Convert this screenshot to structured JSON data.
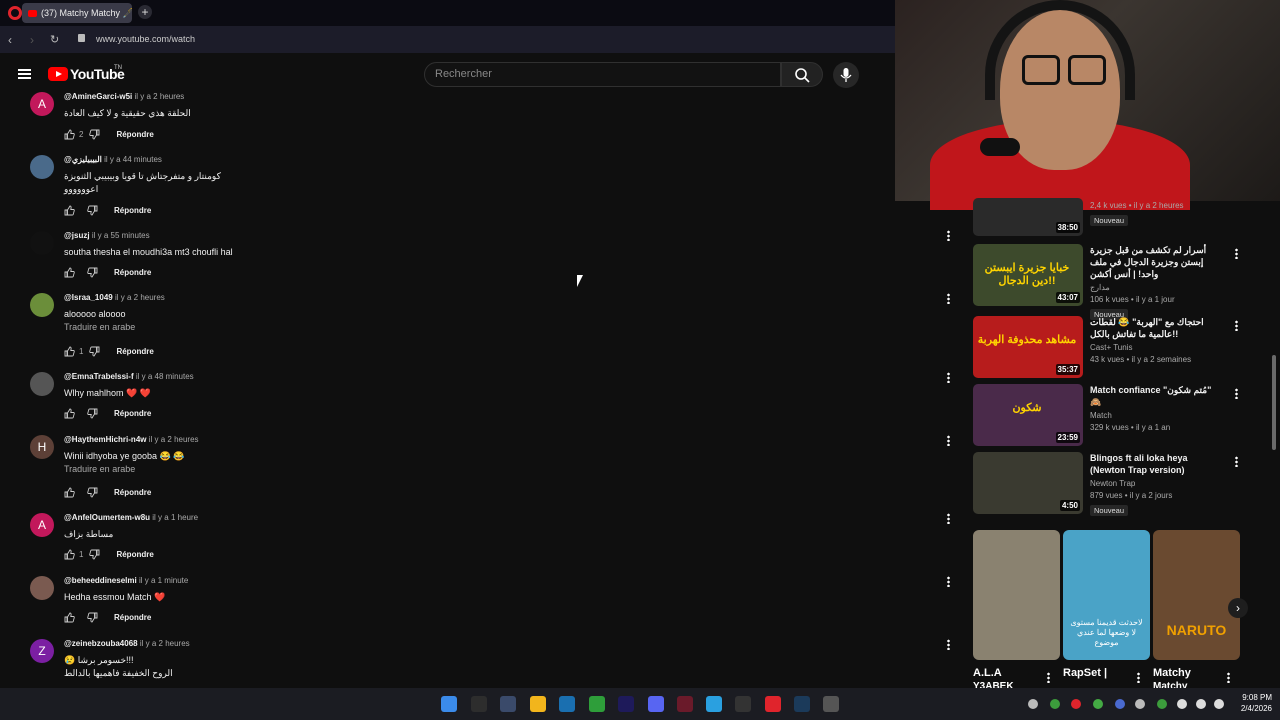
{
  "browser": {
    "tab_title": "(37) Matchy Matchy 🖋️ E",
    "new_tab": "+",
    "url": "www.youtube.com/watch"
  },
  "youtube": {
    "logo_text": "YouTube",
    "logo_sup": "TN",
    "search_placeholder": "Rechercher"
  },
  "comments": [
    {
      "avatar": "A",
      "avatar_color": "#c2185b",
      "handle": "@AmineGarci-w5i",
      "time": "il y a 2 heures",
      "text": "الحلقة هذي حقيقية و لا كيف العادة",
      "likes": "2",
      "reply": "Répondre"
    },
    {
      "avatar": "",
      "avatar_color": "#4a6a8a",
      "handle": "@البيبيليزي",
      "time": "il y a 44 minutes",
      "text": "كومنتار و متفرجتاش تا قويا وبيبيبي الثنويزة",
      "text2": "اعوووووو",
      "likes": "",
      "reply": "Répondre"
    },
    {
      "avatar": "",
      "avatar_color": "#111111",
      "handle": "@jsuzj",
      "time": "il y a 55 minutes",
      "text": "southa thesha el moudhi3a mt3 choufli hal",
      "likes": "",
      "reply": "Répondre"
    },
    {
      "avatar": "",
      "avatar_color": "#6b8e3a",
      "handle": "@Israa_1049",
      "time": "il y a 2 heures",
      "text": "alooooo aloooo",
      "translate": "Traduire en arabe",
      "likes": "1",
      "reply": "Répondre"
    },
    {
      "avatar": "",
      "avatar_color": "#555555",
      "handle": "@EmnaTrabelssi-f",
      "time": "il y a 48 minutes",
      "text": "Wlhy mahlhom ❤️ ❤️",
      "likes": "",
      "reply": "Répondre"
    },
    {
      "avatar": "H",
      "avatar_color": "#5d4037",
      "handle": "@HaythemHichri-n4w",
      "time": "il y a 2 heures",
      "text": "Winii idhyoba ye gooba 😂 😂",
      "translate": "Traduire en arabe",
      "likes": "",
      "reply": "Répondre"
    },
    {
      "avatar": "A",
      "avatar_color": "#c2185b",
      "handle": "@AnfelOumertem-w8u",
      "time": "il y a 1 heure",
      "text": "مساطة بزاف",
      "likes": "1",
      "reply": "Répondre"
    },
    {
      "avatar": "",
      "avatar_color": "#7a5a50",
      "handle": "@beheeddineselmi",
      "time": "il y a 1 minute",
      "text": "Hedha essmou Match ❤️",
      "likes": "",
      "reply": "Répondre"
    },
    {
      "avatar": "Z",
      "avatar_color": "#7b1fa2",
      "handle": "@zeinebzouba4068",
      "time": "il y a 2 heures",
      "text": "😢 خسومر برشا!!!",
      "text2": "الروح الخفيفة فاهميها بالدالط",
      "likes": "",
      "reply": ""
    }
  ],
  "videos": [
    {
      "title": "",
      "channel": "",
      "meta": "2,4 k vues • il y a 2 heures",
      "badge": "Nouveau",
      "duration": "38:50",
      "thumb_color": "#2a2a2a"
    },
    {
      "title": "أسرار لم تكشف من قبل جزيرة إبستن وجزيرة الدجال في ملف واحد! | أنس أكشن",
      "channel": "مدارج",
      "meta": "106 k vues • il y a 1 jour",
      "badge": "Nouveau",
      "duration": "43:07",
      "thumb_color": "#3d4a2c",
      "thumb_text": "خبايا جزيرة ايبستن دين الدجال!!"
    },
    {
      "title": "احتجاك مع \"الهربة\" 😂 لقطات عالمية ما تفاتش بالكل!!",
      "channel": "Cast+ Tunis",
      "meta": "43 k vues • il y a 2 semaines",
      "badge": "",
      "duration": "35:37",
      "thumb_color": "#b71c1c",
      "thumb_text": "مشاهد محذوفة الهربة"
    },
    {
      "title": "Match confiance \"مُتم شكون\" 🙈",
      "channel": "Match",
      "meta": "329 k vues • il y a 1 an",
      "badge": "",
      "duration": "23:59",
      "thumb_color": "#4a2a4a",
      "thumb_text": "شكون"
    },
    {
      "title": "Blingos ft ali loka heya (Newton Trap version)",
      "channel": "Newton Trap",
      "meta": "879 vues • il y a 2 jours",
      "badge": "Nouveau",
      "duration": "4:50",
      "thumb_color": "#3a3a30"
    }
  ],
  "shorts": [
    {
      "title": "A.L.A",
      "subtitle": "Y3ABEK",
      "color": "#8a8270"
    },
    {
      "title": "RapSet |",
      "subtitle": "",
      "color": "#4aa3c7",
      "overlay": "لاحدثت قديمنا مستوى لا وضعها لما عندي موضوع"
    },
    {
      "title": "Matchy",
      "subtitle": "Matchy",
      "color": "#6a4a30",
      "overlay": "NARUTO"
    }
  ],
  "taskbar": {
    "time": "9:08 PM",
    "date": "2/4/2026"
  }
}
